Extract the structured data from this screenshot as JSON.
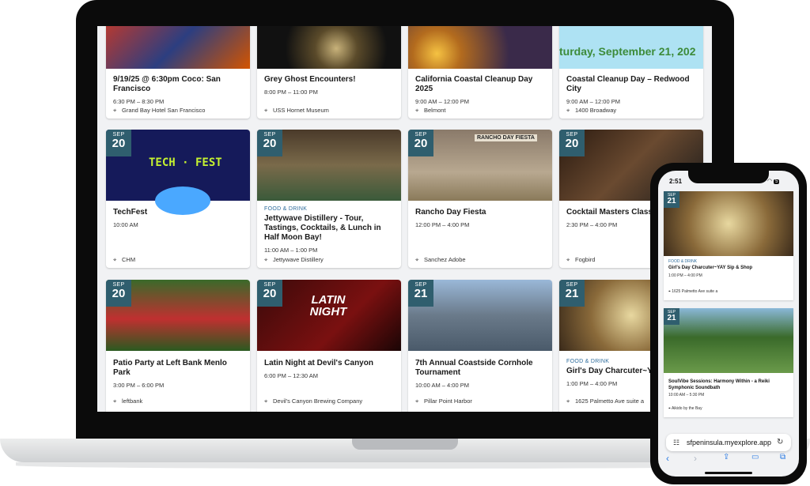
{
  "laptop": {
    "rows": [
      [
        {
          "title": "9/19/25 @ 6:30pm Coco: San Francisco",
          "time": "6:30 PM – 8:30 PM",
          "location": "Grand Bay Hotel San Francisco"
        },
        {
          "title": "Grey Ghost Encounters!",
          "time": "8:00 PM – 11:00 PM",
          "location": "USS Hornet Museum"
        },
        {
          "title": "California Coastal Cleanup Day 2025",
          "time": "9:00 AM – 12:00 PM",
          "location": "Belmont"
        },
        {
          "title": "Coastal Cleanup Day – Redwood City",
          "time": "9:00 AM – 12:00 PM",
          "location": "1400 Broadway",
          "banner": "turday, September 21, 202"
        }
      ],
      [
        {
          "month": "SEP",
          "day": "20",
          "title": "TechFest",
          "time": "10:00 AM",
          "location": "CHM",
          "image_text": "TECH · FEST"
        },
        {
          "month": "SEP",
          "day": "20",
          "category": "FOOD & DRINK",
          "title": "Jettywave Distillery - Tour, Tastings, Cocktails, & Lunch in Half Moon Bay!",
          "time": "11:00 AM – 1:00 PM",
          "location": "Jettywave Distillery"
        },
        {
          "month": "SEP",
          "day": "20",
          "title": "Rancho Day Fiesta",
          "time": "12:00 PM – 4:00 PM",
          "location": "Sanchez Adobe",
          "image_text": "RANCHO DAY FIESTA"
        },
        {
          "month": "SEP",
          "day": "20",
          "title": "Cocktail Masters Class",
          "time": "2:30 PM – 4:00 PM",
          "location": "Fogbird"
        }
      ],
      [
        {
          "month": "SEP",
          "day": "20",
          "title": "Patio Party at Left Bank Menlo Park",
          "time": "3:00 PM – 6:00 PM",
          "location": "leftbank"
        },
        {
          "month": "SEP",
          "day": "20",
          "title": "Latin Night at Devil's Canyon",
          "time": "6:00 PM – 12:30 AM",
          "location": "Devil's Canyon Brewing Company",
          "image_text": "LATIN NIGHT"
        },
        {
          "month": "SEP",
          "day": "21",
          "title": "7th Annual Coastside Cornhole Tournament",
          "time": "10:00 AM – 4:00 PM",
          "location": "Pillar Point Harbor"
        },
        {
          "month": "SEP",
          "day": "21",
          "category": "FOOD & DRINK",
          "title": "Girl's Day Charcuter~YAY",
          "time": "1:00 PM – 4:00 PM",
          "location": "1625 Palmetto Ave suite a"
        }
      ]
    ]
  },
  "phone": {
    "time": "2:51",
    "battery": "5",
    "url": "sfpeninsula.myexplore.app",
    "cards": [
      {
        "month": "SEP",
        "day": "21",
        "category": "FOOD & DRINK",
        "title": "Girl's Day Charcuter~YAY Sip & Shop",
        "time": "1:00 PM – 4:00 PM",
        "location": "1625 Palmetto Ave suite a"
      },
      {
        "month": "SEP",
        "day": "21",
        "title": "SoulVibe Sessions: Harmony Within - a Reiki Symphonic Soundbath",
        "time": "10:00 AM – 5:30 PM",
        "location": "Aikido by the Bay"
      }
    ]
  },
  "colors": {
    "badge": "#2f5e6e",
    "category": "#2e6c9c"
  }
}
